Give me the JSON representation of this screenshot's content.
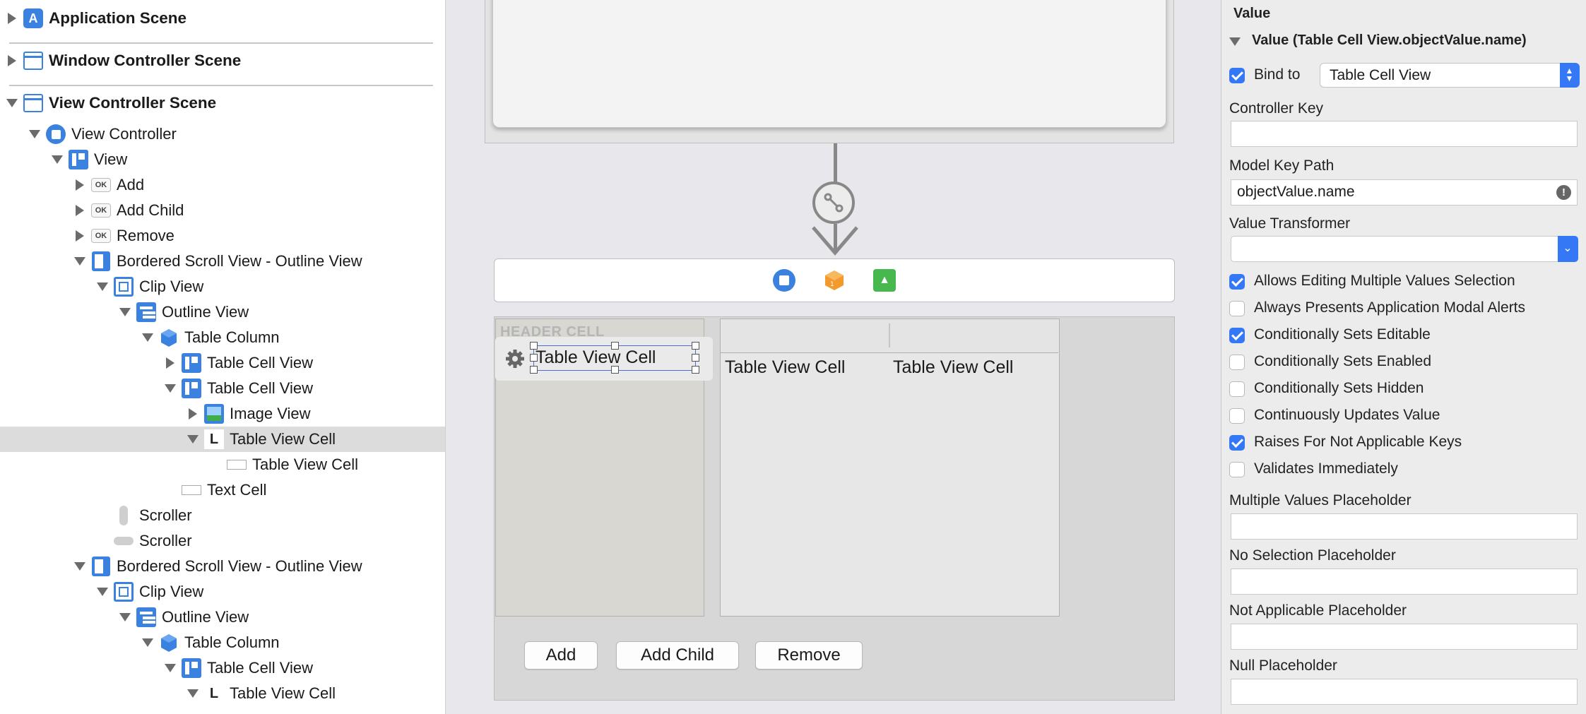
{
  "outline": {
    "rows": [
      {
        "label": "Application Scene"
      },
      {
        "label": "Window Controller Scene"
      },
      {
        "label": "View Controller Scene"
      },
      {
        "label": "View Controller"
      },
      {
        "label": "View"
      },
      {
        "label": "Add",
        "badge": "OK"
      },
      {
        "label": "Add Child",
        "badge": "OK"
      },
      {
        "label": "Remove",
        "badge": "OK"
      },
      {
        "label": "Bordered Scroll View - Outline View"
      },
      {
        "label": "Clip View"
      },
      {
        "label": "Outline View"
      },
      {
        "label": "Table Column"
      },
      {
        "label": "Table Cell View"
      },
      {
        "label": "Table Cell View"
      },
      {
        "label": "Image View"
      },
      {
        "label": "Table View Cell",
        "selected": true
      },
      {
        "label": "Table View Cell"
      },
      {
        "label": "Text Cell"
      },
      {
        "label": "Scroller"
      },
      {
        "label": "Scroller"
      },
      {
        "label": "Bordered Scroll View - Outline View"
      },
      {
        "label": "Clip View"
      },
      {
        "label": "Outline View"
      },
      {
        "label": "Table Column"
      },
      {
        "label": "Table Cell View"
      },
      {
        "label": "Table View Cell"
      }
    ]
  },
  "canvas": {
    "header_cell": "HEADER CELL",
    "cell_text": "Table View Cell",
    "column_cells": [
      "Table View Cell",
      "Table View Cell"
    ],
    "buttons": {
      "add": "Add",
      "add_child": "Add Child",
      "remove": "Remove"
    }
  },
  "inspector": {
    "section_title": "Value",
    "binding_title": "Value (Table Cell View.objectValue.name)",
    "bind_to_label": "Bind to",
    "bind_to_value": "Table Cell View",
    "bind_to_checked": true,
    "controller_key_label": "Controller Key",
    "controller_key_value": "",
    "model_key_path_label": "Model Key Path",
    "model_key_path_value": "objectValue.name",
    "value_transformer_label": "Value Transformer",
    "value_transformer_value": "",
    "options": [
      {
        "label": "Allows Editing Multiple Values Selection",
        "checked": true
      },
      {
        "label": "Always Presents Application Modal Alerts",
        "checked": false
      },
      {
        "label": "Conditionally Sets Editable",
        "checked": true
      },
      {
        "label": "Conditionally Sets Enabled",
        "checked": false
      },
      {
        "label": "Conditionally Sets Hidden",
        "checked": false
      },
      {
        "label": "Continuously Updates Value",
        "checked": false
      },
      {
        "label": "Raises For Not Applicable Keys",
        "checked": true
      },
      {
        "label": "Validates Immediately",
        "checked": false
      }
    ],
    "placeholders": [
      {
        "label": "Multiple Values Placeholder",
        "value": ""
      },
      {
        "label": "No Selection Placeholder",
        "value": ""
      },
      {
        "label": "Not Applicable Placeholder",
        "value": ""
      },
      {
        "label": "Null Placeholder",
        "value": ""
      }
    ],
    "accent_color": "#3478f6"
  }
}
